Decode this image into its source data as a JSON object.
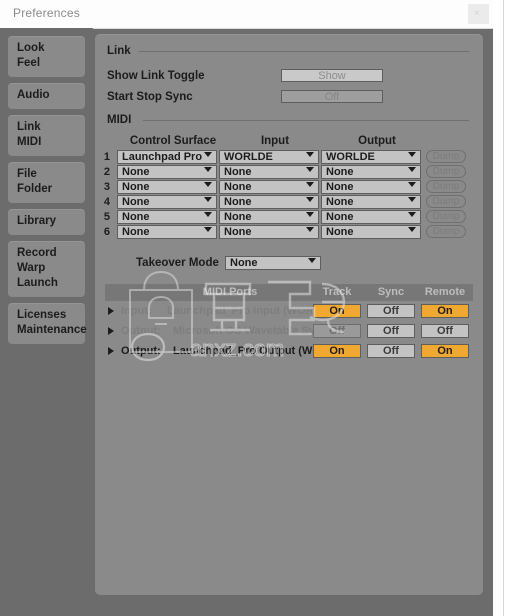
{
  "window": {
    "title": "Preferences",
    "close_glyph": "×"
  },
  "sidebar": {
    "groups": [
      {
        "items": [
          "Look",
          "Feel"
        ]
      },
      {
        "items": [
          "Audio"
        ]
      },
      {
        "items": [
          "Link",
          "MIDI"
        ]
      },
      {
        "items": [
          "File",
          "Folder"
        ]
      },
      {
        "items": [
          "Library"
        ]
      },
      {
        "items": [
          "Record",
          "Warp",
          "Launch"
        ]
      },
      {
        "items": [
          "Licenses",
          "Maintenance"
        ]
      }
    ]
  },
  "link_section": {
    "heading": "Link",
    "rows": [
      {
        "label": "Show Link Toggle",
        "value": "Show"
      },
      {
        "label": "Start Stop Sync",
        "value": "Off"
      }
    ]
  },
  "midi_section": {
    "heading": "MIDI",
    "columns": [
      "Control Surface",
      "Input",
      "Output"
    ],
    "dump_label": "Dump",
    "rows": [
      {
        "num": "1",
        "control_surface": "Launchpad Pro",
        "input": "WORLDE",
        "output": "WORLDE"
      },
      {
        "num": "2",
        "control_surface": "None",
        "input": "None",
        "output": "None"
      },
      {
        "num": "3",
        "control_surface": "None",
        "input": "None",
        "output": "None"
      },
      {
        "num": "4",
        "control_surface": "None",
        "input": "None",
        "output": "None"
      },
      {
        "num": "5",
        "control_surface": "None",
        "input": "None",
        "output": "None"
      },
      {
        "num": "6",
        "control_surface": "None",
        "input": "None",
        "output": "None"
      }
    ],
    "takeover": {
      "label": "Takeover Mode",
      "value": "None"
    }
  },
  "ports_table": {
    "headers": [
      "MIDI Ports",
      "Track",
      "Sync",
      "Remote"
    ],
    "rows": [
      {
        "direction": "Input:",
        "name": "Launchpad_Pro Input (WORLDE )",
        "track": "On",
        "sync": "Off",
        "remote": "On"
      },
      {
        "direction": "Output:",
        "name": "Microsoft GS Wavetable Synth",
        "track": "Off",
        "sync": "Off",
        "remote": "Off"
      },
      {
        "direction": "Output:",
        "name": "Launchpad_Pro Output (WORLDE",
        "track": "On",
        "sync": "Off",
        "remote": "On"
      }
    ]
  },
  "watermark": {
    "text_cn": "安下载",
    "text_url": "anxz.com"
  },
  "colors": {
    "accent_on": "#f0a830",
    "panel": "#8a8a8a",
    "window": "#6c6c6c",
    "titlebar": "#fdfdfd"
  }
}
